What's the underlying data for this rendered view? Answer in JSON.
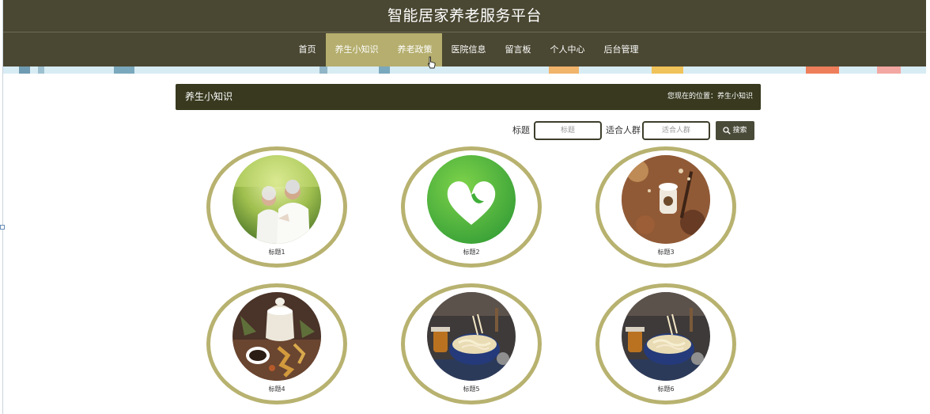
{
  "site": {
    "title": "智能居家养老服务平台"
  },
  "nav": {
    "items": [
      {
        "label": "首页"
      },
      {
        "label": "养生小知识"
      },
      {
        "label": "养老政策"
      },
      {
        "label": "医院信息"
      },
      {
        "label": "留言板"
      },
      {
        "label": "个人中心"
      },
      {
        "label": "后台管理"
      }
    ],
    "active_index": 1
  },
  "breadcrumb": {
    "title": "养生小知识",
    "location": "您现在的位置：养生小知识"
  },
  "search": {
    "title_label": "标题",
    "title_placeholder": "标题",
    "group_label": "适合人群",
    "group_placeholder": "适合人群",
    "button_label": "搜索"
  },
  "cards": [
    {
      "label": "标题1",
      "image": "elderly-couple-photo"
    },
    {
      "label": "标题2",
      "image": "green-heart-logo"
    },
    {
      "label": "标题3",
      "image": "herbal-ingredients-photo"
    },
    {
      "label": "标题4",
      "image": "herbal-tea-pot-photo"
    },
    {
      "label": "标题5",
      "image": "noodle-bowl-photo"
    },
    {
      "label": "标题6",
      "image": "noodle-bowl-photo"
    }
  ],
  "colors": {
    "header_bg": "#4a4732",
    "nav_active": "#b5ae6e",
    "crumb_bg": "#38391f",
    "ring": "#b8b270"
  }
}
